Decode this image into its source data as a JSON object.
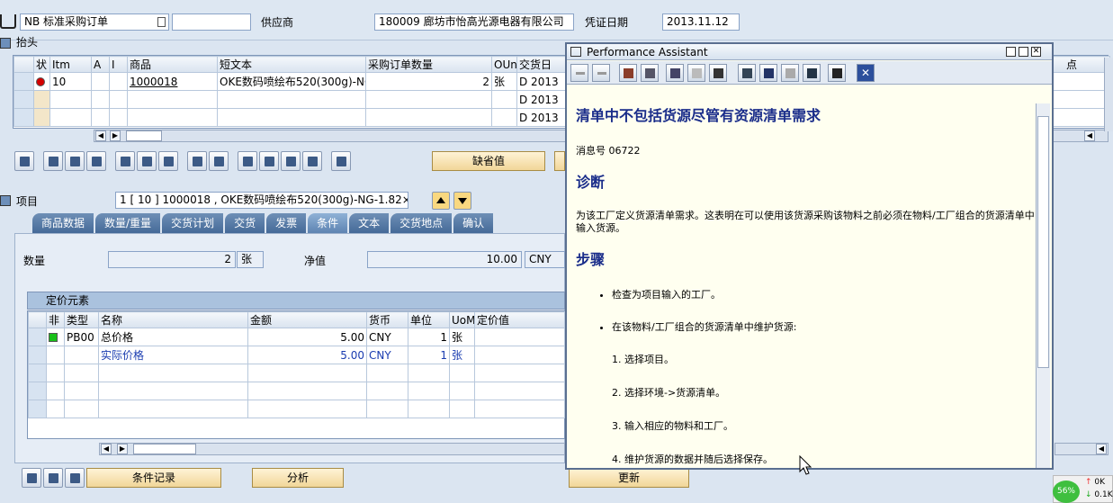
{
  "header": {
    "doc_type": "NB 标准采购订单",
    "supplier_label": "供应商",
    "supplier_value": "180009 廊坊市怡高光源电器有限公司",
    "date_label": "凭证日期",
    "date_value": "2013.11.12"
  },
  "section_header": "抬头",
  "items_table": {
    "columns": [
      "状",
      "Itm",
      "A",
      "I",
      "商品",
      "短文本",
      "采购订单数量",
      "OUn",
      "交货日"
    ],
    "rows": [
      {
        "itm": "10",
        "material": "1000018",
        "short_text": "OKE数码喷绘布520(300g)-NG-",
        "qty": "2",
        "oun": "张",
        "date": "D 2013"
      },
      {
        "date": "D 2013"
      },
      {
        "date": "D 2013"
      }
    ],
    "extra_col": "点"
  },
  "toolbar": {
    "default_button": "缺省值"
  },
  "item": {
    "label": "项目",
    "value": "1 [ 10 ] 1000018 , OKE数码喷绘布520(300g)-NG-1.82×"
  },
  "tabs": [
    "商品数据",
    "数量/重量",
    "交货计划",
    "交货",
    "发票",
    "条件",
    "文本",
    "交货地点",
    "确认"
  ],
  "active_tab": "条件",
  "conditions": {
    "qty_label": "数量",
    "qty_value": "2",
    "qty_unit": "张",
    "net_label": "净值",
    "net_value": "10.00",
    "currency": "CNY"
  },
  "pricing": {
    "title": "定价元素",
    "columns": [
      "非",
      "类型",
      "名称",
      "金额",
      "货币",
      "单位",
      "UoM",
      "定价值"
    ],
    "rows": [
      {
        "type": "PB00",
        "name": "总价格",
        "amount": "5.00",
        "currency": "CNY",
        "unit": "1",
        "uom": "张"
      },
      {
        "type": "",
        "name": "实际价格",
        "amount": "5.00",
        "currency": "CNY",
        "unit": "1",
        "uom": "张"
      }
    ]
  },
  "bottom_buttons": {
    "condition_record": "条件记录",
    "analysis": "分析",
    "update": "更新"
  },
  "assistant": {
    "window_title": "Performance Assistant",
    "heading": "清单中不包括货源尽管有资源清单需求",
    "msg_no": "消息号 06722",
    "diag": "诊断",
    "diag_text": "为该工厂定义货源清单需求。这表明在可以使用该货源采购该物料之前必须在物料/工厂组合的货源清单中输入货源。",
    "steps_title": "步骤",
    "bullets": [
      "检查为项目输入的工厂。",
      "在该物料/工厂组合的货源清单中维护货源:"
    ],
    "steps": [
      "1. 选择项目。",
      "2. 选择环境->货源清单。",
      "3. 输入相应的物料和工厂。",
      "4. 维护货源的数据并随后选择保存。"
    ]
  },
  "tray": {
    "percent": "56%",
    "ok": "0K",
    "speed": "0.1K"
  },
  "colors": {
    "accent": "#456a98",
    "title_blue": "#1a2d8a"
  }
}
